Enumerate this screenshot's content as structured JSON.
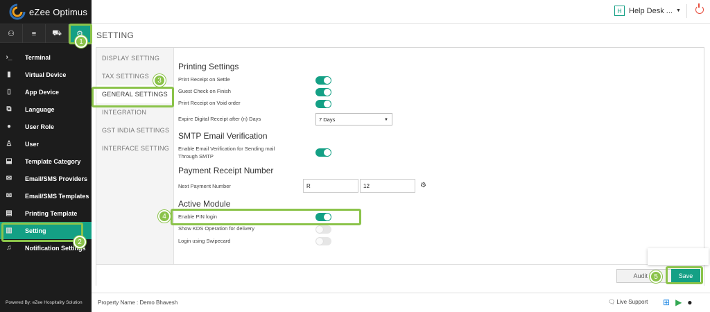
{
  "app": {
    "title": "eZee Optimus",
    "brand_color": "#14a085",
    "powered_by": "Powered By: eZee Hospitality Solution"
  },
  "header": {
    "helpdesk_label": "Help Desk ...",
    "helpdesk_icon_letter": "H"
  },
  "top_icons": [
    {
      "icon": "user-icon",
      "glyph": "⚇"
    },
    {
      "icon": "menu-icon",
      "glyph": "≡"
    },
    {
      "icon": "store-icon",
      "glyph": "⛟"
    },
    {
      "icon": "gear-icon",
      "glyph": "⚙"
    }
  ],
  "sidebar": {
    "items": [
      {
        "label": "Terminal",
        "icon": "terminal-icon",
        "glyph": "›_"
      },
      {
        "label": "Virtual Device",
        "icon": "tablet-icon",
        "glyph": "▮"
      },
      {
        "label": "App Device",
        "icon": "phone-icon",
        "glyph": "▯"
      },
      {
        "label": "Language",
        "icon": "language-icon",
        "glyph": "⧉"
      },
      {
        "label": "User Role",
        "icon": "user-role-icon",
        "glyph": "●"
      },
      {
        "label": "User",
        "icon": "user-icon",
        "glyph": "♙"
      },
      {
        "label": "Template Category",
        "icon": "inbox-icon",
        "glyph": "⬓"
      },
      {
        "label": "Email/SMS Providers",
        "icon": "email-icon",
        "glyph": "✉"
      },
      {
        "label": "Email/SMS Templates",
        "icon": "email-template-icon",
        "glyph": "✉"
      },
      {
        "label": "Printing Template",
        "icon": "printer-icon",
        "glyph": "▤"
      },
      {
        "label": "Setting",
        "icon": "setting-icon",
        "glyph": "▥"
      },
      {
        "label": "Notification Settings",
        "icon": "bell-icon",
        "glyph": "♫"
      }
    ]
  },
  "page": {
    "title": "SETTING"
  },
  "tabs": [
    "DISPLAY SETTING",
    "TAX SETTINGS",
    "GENERAL SETTINGS",
    "INTEGRATION",
    "GST INDIA SETTINGS",
    "INTERFACE SETTING"
  ],
  "printing": {
    "title": "Printing Settings",
    "print_on_settle": "Print Receipt on Settle",
    "guest_check": "Guest Check on Finish",
    "print_on_void": "Print Receipt on Void order",
    "expire_label": "Expire Digital Receipt after (n) Days",
    "expire_value": "7 Days",
    "toggles": [
      true,
      true,
      true
    ]
  },
  "smtp": {
    "title": "SMTP Email Verification",
    "label_line1": "Enable Email Verification for Sending mail",
    "label_line2": "Through SMTP",
    "enabled": true
  },
  "payment": {
    "title": "Payment Receipt Number",
    "label": "Next Payment Number",
    "prefix": "R",
    "number": "12"
  },
  "active_module": {
    "title": "Active Module",
    "pin_login": "Enable PIN login",
    "kds": "Show KDS Operation for delivery",
    "swipecard": "Login using Swipecard",
    "toggles": [
      true,
      false,
      false
    ]
  },
  "actions": {
    "audit": "Audit Tr",
    "save": "Save"
  },
  "footer": {
    "property": "Property Name : Demo Bhavesh",
    "live_support": "Live Support"
  },
  "annotations": [
    "1",
    "2",
    "3",
    "4",
    "5"
  ],
  "colors": {
    "highlight": "#8bc34a",
    "sidebar_bg": "#1c1c1c"
  }
}
